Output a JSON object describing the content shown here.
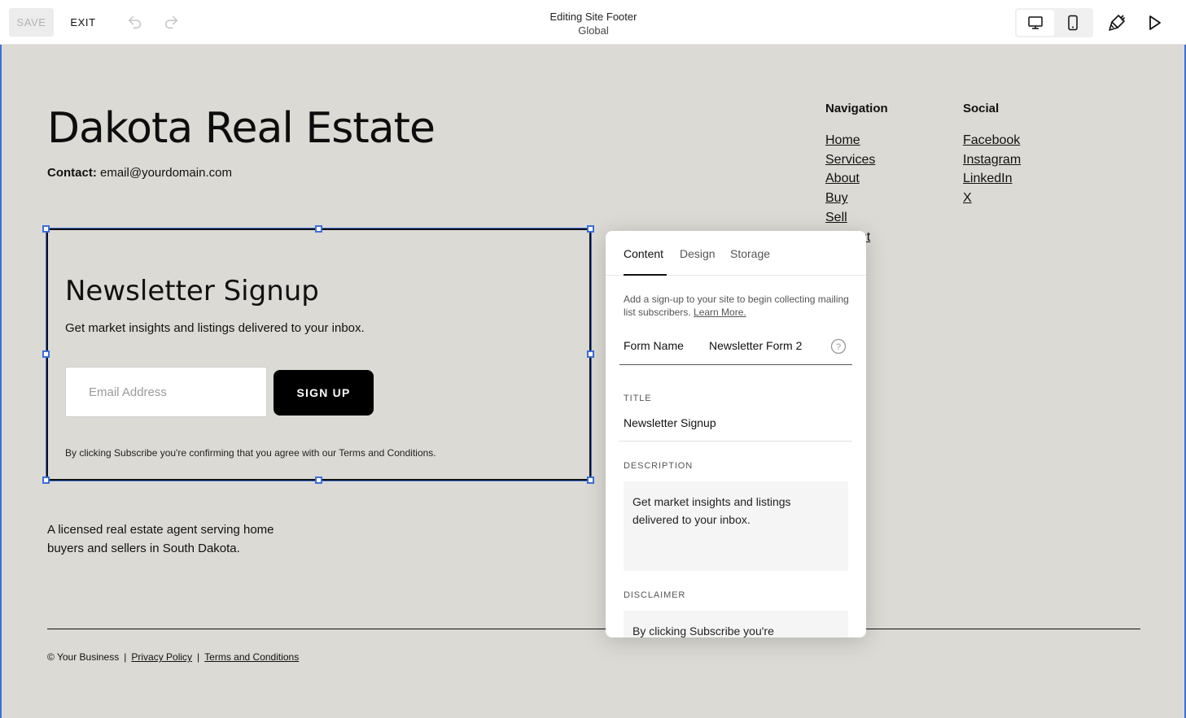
{
  "toolbar": {
    "save_label": "SAVE",
    "exit_label": "EXIT",
    "title": "Editing Site Footer",
    "subtitle": "Global",
    "icons": [
      "undo-icon",
      "redo-icon",
      "desktop-icon",
      "mobile-icon",
      "paintbrush-icon",
      "play-icon"
    ]
  },
  "footer": {
    "site_title": "Dakota Real Estate",
    "contact_label": "Contact:",
    "contact_email": "email@yourdomain.com",
    "navigation": {
      "heading": "Navigation",
      "links": [
        "Home",
        "Services",
        "About",
        "Buy",
        "Sell",
        "Contact"
      ]
    },
    "social": {
      "heading": "Social",
      "links": [
        "Facebook",
        "Instagram",
        "LinkedIn",
        "X"
      ]
    },
    "newsletter": {
      "title": "Newsletter Signup",
      "description": "Get market insights and listings delivered to your inbox.",
      "email_placeholder": "Email Address",
      "button_label": "SIGN UP",
      "disclaimer": "By clicking Subscribe you're confirming that you agree with our Terms and Conditions."
    },
    "about": "A licensed real estate agent serving home buyers and sellers in South Dakota.",
    "copyright": "© Your Business",
    "privacy_link": "Privacy Policy",
    "terms_link": "Terms and Conditions"
  },
  "panel": {
    "tabs": [
      "Content",
      "Design",
      "Storage"
    ],
    "active_tab": "Content",
    "intro": "Add a sign-up to your site to begin collecting mailing list subscribers.",
    "learn_more": "Learn More.",
    "form_name_label": "Form Name",
    "form_name_value": "Newsletter Form 2",
    "title_label": "TITLE",
    "title_value": "Newsletter Signup",
    "description_label": "DESCRIPTION",
    "description_value": "Get market insights and listings delivered to your inbox.",
    "disclaimer_label": "DISCLAIMER",
    "disclaimer_value": "By clicking Subscribe you're"
  },
  "colors": {
    "canvas_bg": "#dcdad4",
    "selection": "#3c6fd9",
    "button_bg": "#000000"
  }
}
